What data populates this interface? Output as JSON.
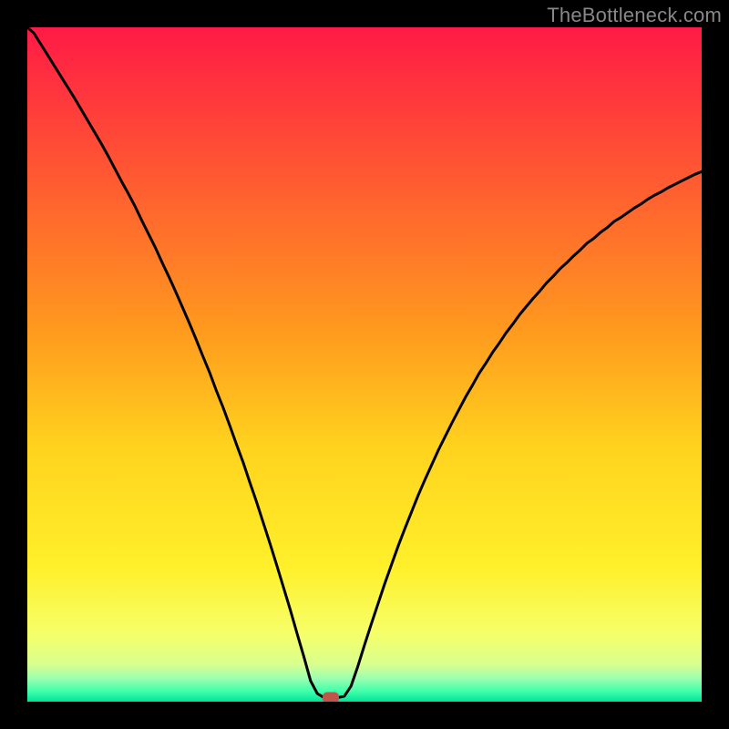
{
  "watermark": "TheBottleneck.com",
  "chart_data": {
    "type": "line",
    "title": "",
    "xlabel": "",
    "ylabel": "",
    "xlim": [
      0,
      100
    ],
    "ylim": [
      0,
      100
    ],
    "series": [
      {
        "name": "bottleneck-curve",
        "x": [
          0,
          1,
          2,
          3,
          4,
          5,
          6,
          7,
          8,
          9,
          10,
          11,
          12,
          13,
          14,
          15,
          16,
          17,
          18,
          19,
          20,
          21,
          22,
          23,
          24,
          25,
          26,
          27,
          28,
          29,
          30,
          31,
          32,
          33,
          34,
          35,
          36,
          37,
          38,
          39,
          40,
          41,
          42,
          43,
          44,
          45,
          46,
          47,
          48,
          49,
          50,
          51,
          52,
          53,
          54,
          55,
          56,
          57,
          58,
          59,
          60,
          61,
          62,
          63,
          64,
          65,
          66,
          67,
          68,
          69,
          70,
          71,
          72,
          73,
          74,
          75,
          76,
          77,
          78,
          79,
          80,
          81,
          82,
          83,
          84,
          85,
          86,
          87,
          88,
          89,
          90,
          91,
          92,
          93,
          94,
          95,
          96,
          97,
          98,
          99,
          100
        ],
        "y": [
          100,
          99.1,
          97.5,
          95.9,
          94.3,
          92.7,
          91.1,
          89.5,
          87.8,
          86.1,
          84.4,
          82.7,
          80.9,
          79,
          77.1,
          75.3,
          73.4,
          71.3,
          69.3,
          67.3,
          65.1,
          63,
          60.8,
          58.5,
          56.2,
          53.8,
          51.3,
          48.9,
          46.2,
          43.7,
          41,
          38.2,
          35.5,
          32.5,
          29.6,
          26.5,
          23.4,
          20.2,
          16.9,
          13.6,
          10.1,
          6.7,
          3.1,
          1.2,
          0.6,
          0.6,
          0.6,
          0.8,
          2.3,
          5.2,
          8.4,
          11.5,
          14.5,
          17.5,
          20.3,
          23.1,
          25.7,
          28.2,
          30.7,
          33,
          35.2,
          37.4,
          39.4,
          41.4,
          43.3,
          45.2,
          46.9,
          48.7,
          50.2,
          51.8,
          53.2,
          54.7,
          56,
          57.4,
          58.6,
          59.8,
          60.9,
          62.1,
          63.1,
          64.2,
          65.1,
          66.1,
          67,
          68,
          68.7,
          69.6,
          70.3,
          71.2,
          71.8,
          72.5,
          73.2,
          73.8,
          74.5,
          75.1,
          75.6,
          76.2,
          76.7,
          77.2,
          77.7,
          78.2,
          78.6
        ]
      }
    ],
    "optimum_marker": {
      "x": 45,
      "y": 0.6
    },
    "background_gradient": {
      "stops": [
        {
          "offset": 0.0,
          "color": "#ff1a46"
        },
        {
          "offset": 0.45,
          "color": "#ff9a1e"
        },
        {
          "offset": 0.62,
          "color": "#ffd21e"
        },
        {
          "offset": 0.8,
          "color": "#fff02a"
        },
        {
          "offset": 0.9,
          "color": "#f6ff6a"
        },
        {
          "offset": 0.945,
          "color": "#d8ff8f"
        },
        {
          "offset": 0.965,
          "color": "#9dffb1"
        },
        {
          "offset": 0.985,
          "color": "#3effab"
        },
        {
          "offset": 1.0,
          "color": "#00e29a"
        }
      ]
    }
  }
}
